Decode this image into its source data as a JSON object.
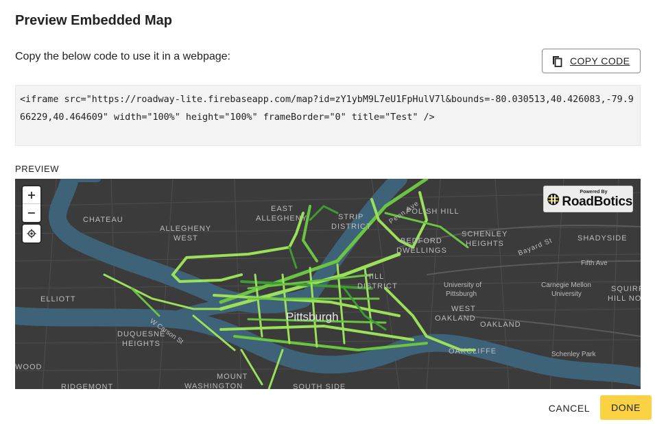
{
  "dialog": {
    "title": "Preview Embedded Map",
    "instructions": "Copy the below code to use it in a webpage:",
    "copy_label": "COPY CODE",
    "copy_icon": "copy-icon",
    "embed_code": "<iframe src=\"https://roadway-lite.firebaseapp.com/map?id=zY1ybM9L7eU1FpHulV7l&bounds=-80.030513,40.426083,-79.966229,40.464609\" width=\"100%\" height=\"100%\" frameBorder=\"0\" title=\"Test\" />",
    "preview_label": "PREVIEW",
    "cancel_label": "CANCEL",
    "done_label": "DONE"
  },
  "map": {
    "controls": {
      "zoom_in": "+",
      "zoom_out": "−",
      "locate_icon": "locate-icon"
    },
    "logo": {
      "powered": "Powered By",
      "brand": "RoadBotics"
    },
    "labels": [
      {
        "id": "chateau",
        "text": "CHATEAU"
      },
      {
        "id": "allegheny-west-1",
        "text": "ALLEGHENY"
      },
      {
        "id": "allegheny-west-2",
        "text": "WEST"
      },
      {
        "id": "east-allegheny-1",
        "text": "EAST"
      },
      {
        "id": "east-allegheny-2",
        "text": "ALLEGHENY"
      },
      {
        "id": "strip-district-1",
        "text": "STRIP"
      },
      {
        "id": "strip-district-2",
        "text": "DISTRICT"
      },
      {
        "id": "polish-hill",
        "text": "POLISH HILL"
      },
      {
        "id": "penn-ave",
        "text": "Penn Ave"
      },
      {
        "id": "bedford-dwellings-1",
        "text": "BEDFORD"
      },
      {
        "id": "bedford-dwellings-2",
        "text": "DWELLINGS"
      },
      {
        "id": "schenley-heights-1",
        "text": "SCHENLEY"
      },
      {
        "id": "schenley-heights-2",
        "text": "HEIGHTS"
      },
      {
        "id": "bayard-st",
        "text": "Bayard St"
      },
      {
        "id": "shadyside",
        "text": "SHADYSIDE"
      },
      {
        "id": "fifth-ave",
        "text": "Fifth Ave"
      },
      {
        "id": "hill-district-1",
        "text": "HILL"
      },
      {
        "id": "hill-district-2",
        "text": "DISTRICT"
      },
      {
        "id": "pitt-1",
        "text": "University of"
      },
      {
        "id": "pitt-2",
        "text": "Pittsburgh"
      },
      {
        "id": "cmu-1",
        "text": "Carnegie Mellon"
      },
      {
        "id": "cmu-2",
        "text": "University"
      },
      {
        "id": "squirrel-hill-1",
        "text": "SQUIRREL"
      },
      {
        "id": "squirrel-hill-2",
        "text": "HILL NO"
      },
      {
        "id": "elliott",
        "text": "ELLIOTT"
      },
      {
        "id": "pittsburgh",
        "text": "Pittsburgh"
      },
      {
        "id": "west-oakland-1",
        "text": "WEST"
      },
      {
        "id": "west-oakland-2",
        "text": "OAKLAND"
      },
      {
        "id": "oakland",
        "text": "OAKLAND"
      },
      {
        "id": "w-carson-st",
        "text": "W Carson St"
      },
      {
        "id": "duquesne-heights-1",
        "text": "DUQUESNE"
      },
      {
        "id": "duquesne-heights-2",
        "text": "HEIGHTS"
      },
      {
        "id": "oakcliffe",
        "text": "OAKCLIFFE"
      },
      {
        "id": "schenley-park",
        "text": "Schenley Park"
      },
      {
        "id": "wood",
        "text": "WOOD"
      },
      {
        "id": "mount-washington-1",
        "text": "MOUNT"
      },
      {
        "id": "mount-washington-2",
        "text": "WASHINGTON"
      },
      {
        "id": "ridgemont",
        "text": "RIDGEMONT"
      },
      {
        "id": "south-side",
        "text": "SOUTH SIDE"
      }
    ],
    "colors": {
      "land": "#3b3b3b",
      "water": "#3e6277",
      "road": "#555555",
      "segment_light": "#9be05a",
      "segment_mid": "#6cc443",
      "segment_dark": "#3f9a34"
    }
  }
}
